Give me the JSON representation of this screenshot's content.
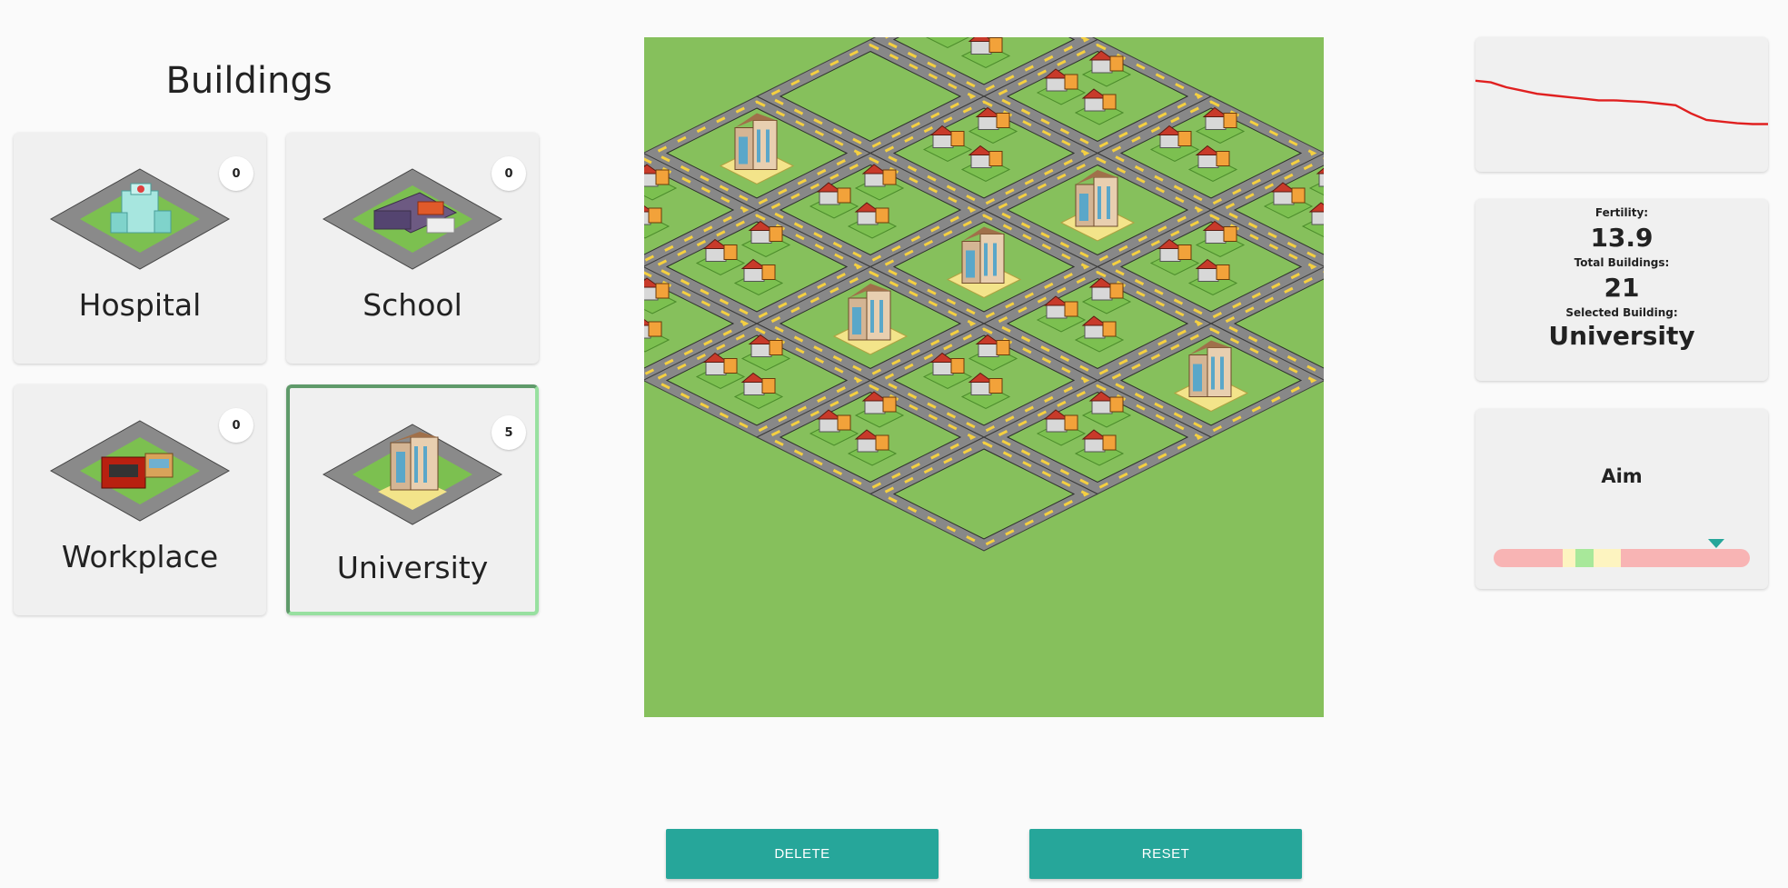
{
  "sidebar": {
    "title": "Buildings",
    "cards": [
      {
        "label": "Hospital",
        "count": "0",
        "icon": "hospital-icon"
      },
      {
        "label": "School",
        "count": "0",
        "icon": "school-icon"
      },
      {
        "label": "Workplace",
        "count": "0",
        "icon": "workplace-icon"
      },
      {
        "label": "University",
        "count": "5",
        "icon": "university-icon",
        "selected": true
      }
    ]
  },
  "map": {
    "grid_size": 5,
    "tiles": [
      [
        "houses",
        "houses",
        "houses",
        "houses",
        "houses"
      ],
      [
        "park",
        "houses",
        "university",
        "houses",
        "park"
      ],
      [
        "university",
        "houses",
        "university",
        "houses",
        "university"
      ],
      [
        "houses",
        "houses",
        "university",
        "houses",
        "houses"
      ],
      [
        "park",
        "houses",
        "houses",
        "houses",
        "park"
      ]
    ]
  },
  "stats": {
    "fertility_label": "Fertility:",
    "fertility_value": "13.9",
    "total_label": "Total Buildings:",
    "total_value": "21",
    "selected_label": "Selected Building:",
    "selected_value": "University"
  },
  "trend": {
    "line_color": "#e02020",
    "values": [
      0.58,
      0.56,
      0.5,
      0.46,
      0.42,
      0.4,
      0.38,
      0.36,
      0.34,
      0.34,
      0.33,
      0.32,
      0.3,
      0.28,
      0.18,
      0.1,
      0.08,
      0.06,
      0.05,
      0.05
    ]
  },
  "aim": {
    "title": "Aim",
    "marker_position": 0.87,
    "colors": {
      "red": "#f8b4b4",
      "yellow": "#fdf4c0",
      "green": "#a8e89a",
      "marker": "#26a69a"
    }
  },
  "buttons": {
    "delete_label": "DELETE",
    "reset_label": "RESET",
    "color": "#26a69a"
  }
}
